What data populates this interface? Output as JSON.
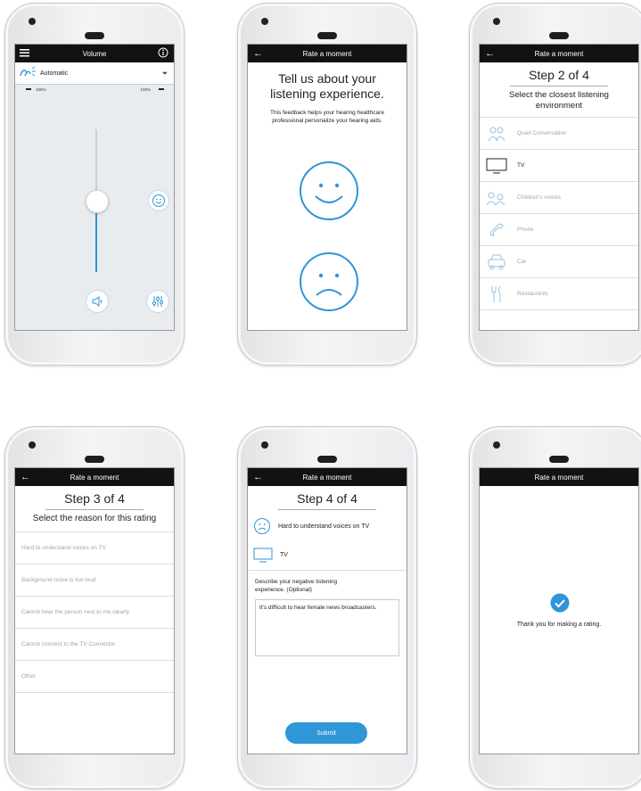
{
  "screen1": {
    "title": "Volume",
    "program": "Automatic",
    "left_pct": "100%",
    "right_pct": "100%",
    "volume_level": 0.6
  },
  "screen2": {
    "header": "Rate a moment",
    "heading": "Tell us about your listening experience.",
    "body": "This feedback helps your hearing healthcare professional personalize your hearing aids."
  },
  "screen3": {
    "header": "Rate a moment",
    "step": "Step 2 of 4",
    "subtitle": "Select the closest listening environment",
    "items": [
      {
        "label": "Quiet Conversation",
        "icon": "people-icon"
      },
      {
        "label": "TV",
        "icon": "tv-icon"
      },
      {
        "label": "Children's voices",
        "icon": "children-icon"
      },
      {
        "label": "Phone",
        "icon": "phone-icon"
      },
      {
        "label": "Car",
        "icon": "car-icon"
      },
      {
        "label": "Restaurants",
        "icon": "cutlery-icon"
      }
    ]
  },
  "screen4": {
    "header": "Rate a moment",
    "step": "Step 3 of 4",
    "subtitle": "Select the reason for this rating",
    "items": [
      "Hard to understand voices on TV",
      "Background noise is too loud",
      "Cannot hear the person next to me clearly",
      "Cannot connect to the TV Connector",
      "Other"
    ]
  },
  "screen5": {
    "header": "Rate a moment",
    "step": "Step 4 of 4",
    "reason": "Hard to understand voices on TV",
    "environment": "TV",
    "describe_label": "Describe your negative listening experience. (Optional)",
    "comment": "It's difficult to hear female news broadcasters.",
    "submit": "Submit"
  },
  "screen6": {
    "header": "Rate a moment",
    "message": "Thank you for making a rating."
  },
  "colors": {
    "accent": "#2f96d8",
    "bar": "#121212"
  }
}
